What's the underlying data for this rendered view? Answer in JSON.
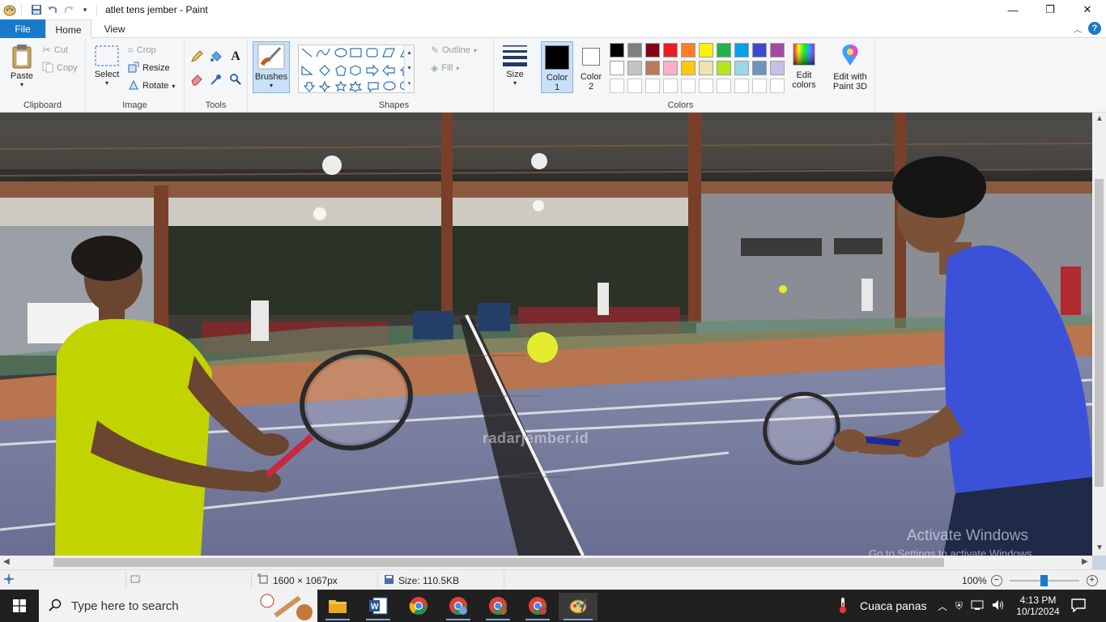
{
  "window": {
    "title": "atlet tens jember - Paint",
    "minimize": "—",
    "maximize": "❐",
    "close": "✕"
  },
  "tabs": {
    "file": "File",
    "home": "Home",
    "view": "View"
  },
  "ribbon": {
    "clipboard": {
      "label": "Clipboard",
      "paste": "Paste",
      "cut": "Cut",
      "copy": "Copy"
    },
    "image": {
      "label": "Image",
      "select": "Select",
      "crop": "Crop",
      "resize": "Resize",
      "rotate": "Rotate"
    },
    "tools": {
      "label": "Tools"
    },
    "brushes": {
      "label": "Brushes"
    },
    "shapes": {
      "label": "Shapes",
      "outline": "Outline",
      "fill": "Fill"
    },
    "size": {
      "label": "Size"
    },
    "colors": {
      "label": "Colors",
      "color1_a": "Color",
      "color1_b": "1",
      "color2_a": "Color",
      "color2_b": "2",
      "edit_a": "Edit",
      "edit_b": "colors",
      "paint3d_a": "Edit with",
      "paint3d_b": "Paint 3D",
      "color1_value": "#000000",
      "color2_value": "#ffffff",
      "palette_row1": [
        "#000000",
        "#7f7f7f",
        "#880015",
        "#ed1c24",
        "#ff7f27",
        "#fff200",
        "#22b14c",
        "#00a2e8",
        "#3f48cc",
        "#a349a4"
      ],
      "palette_row2": [
        "#ffffff",
        "#c3c3c3",
        "#b97a57",
        "#ffaec9",
        "#ffc90e",
        "#efe4b0",
        "#b5e61d",
        "#99d9ea",
        "#7092be",
        "#c8bfe7"
      ]
    }
  },
  "canvas": {
    "watermark": "radarjember.id",
    "activate_title": "Activate Windows",
    "activate_sub": "Go to Settings to activate Windows."
  },
  "status": {
    "dimensions": "1600 × 1067px",
    "size": "Size: 110.5KB",
    "zoom": "100%"
  },
  "taskbar": {
    "search_placeholder": "Type here to search",
    "weather": "Cuaca panas",
    "time": "4:13 PM",
    "date": "10/1/2024"
  }
}
